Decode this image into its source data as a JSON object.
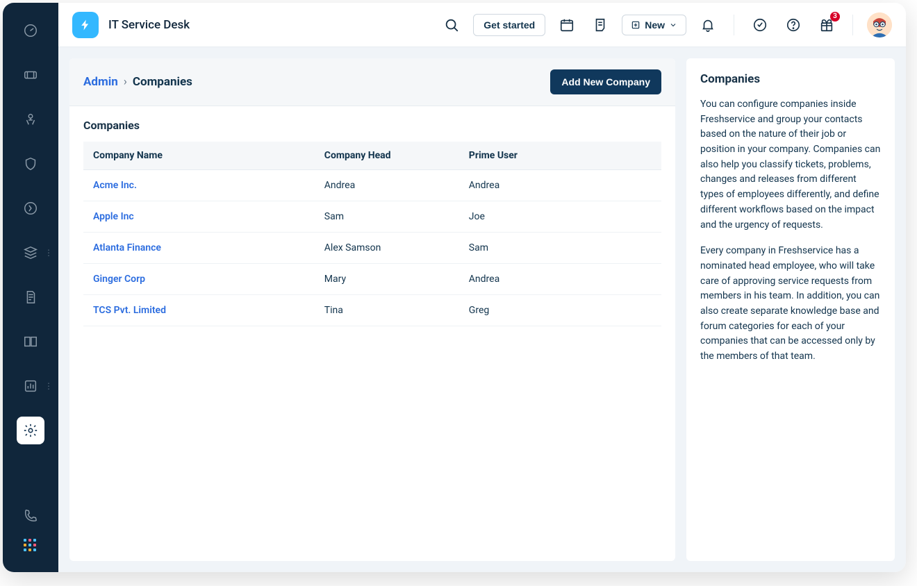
{
  "header": {
    "app_title": "IT Service Desk",
    "get_started_label": "Get started",
    "new_label": "New",
    "gift_badge": "3"
  },
  "breadcrumb": {
    "root": "Admin",
    "current": "Companies"
  },
  "actions": {
    "add_company": "Add New Company"
  },
  "table": {
    "heading": "Companies",
    "columns": [
      "Company Name",
      "Company Head",
      "Prime User"
    ],
    "rows": [
      {
        "name": "Acme Inc.",
        "head": "Andrea",
        "prime": "Andrea"
      },
      {
        "name": "Apple Inc",
        "head": "Sam",
        "prime": "Joe"
      },
      {
        "name": "Atlanta Finance",
        "head": "Alex Samson",
        "prime": "Sam"
      },
      {
        "name": "Ginger Corp",
        "head": "Mary",
        "prime": "Andrea"
      },
      {
        "name": "TCS Pvt. Limited",
        "head": "Tina",
        "prime": "Greg"
      }
    ]
  },
  "help": {
    "title": "Companies",
    "p1": "You can configure companies inside Freshservice and group your contacts based on the nature of their job or position in your company. Companies can also help you classify tickets, problems, changes and releases from different types of employees differently, and define different workflows based on the impact and the urgency of requests.",
    "p2": "Every company in Freshservice has a nominated head employee, who will take care of approving service requests from members in his team. In addition, you can also create separate knowledge base and forum categories for each of your companies that can be accessed only by the members of that team."
  }
}
